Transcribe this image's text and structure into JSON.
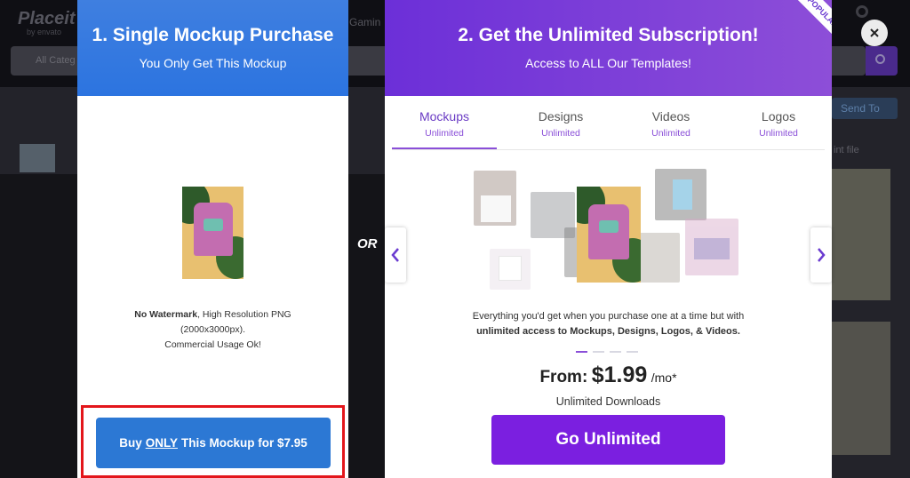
{
  "background": {
    "logo": "Placeit",
    "logo_sub": "by envato",
    "nav_text": "Gamin",
    "search_placeholder": "All Categ",
    "send_button": "Send To",
    "file_text": "int file"
  },
  "single_card": {
    "title": "1. Single Mockup Purchase",
    "subtitle": "You Only Get This Mockup",
    "desc_bold": "No Watermark",
    "desc_line1_rest": ", High Resolution PNG",
    "desc_line2": "(2000x3000px).",
    "desc_line3": "Commercial Usage Ok!",
    "buy_prefix": "Buy",
    "buy_only": "ONLY",
    "buy_suffix": "This Mockup for $7.95"
  },
  "or_label": "OR",
  "subscription_card": {
    "title": "2. Get the Unlimited Subscription!",
    "subtitle": "Access to ALL Our Templates!",
    "ribbon": "POPULAR",
    "tabs": [
      {
        "name": "Mockups",
        "sub": "Unlimited"
      },
      {
        "name": "Designs",
        "sub": "Unlimited"
      },
      {
        "name": "Videos",
        "sub": "Unlimited"
      },
      {
        "name": "Logos",
        "sub": "Unlimited"
      }
    ],
    "desc_line1": "Everything you'd get when you purchase one at a time but with",
    "desc_line2_bold": "unlimited access to Mockups, Designs, Logos, & Videos.",
    "price_from": "From:",
    "price_amount": "$1.99",
    "price_unit": "/mo*",
    "downloads": "Unlimited Downloads",
    "cta": "Go Unlimited"
  },
  "icons": {
    "prev": "chevron-left-icon",
    "next": "chevron-right-icon",
    "close": "close-icon"
  },
  "colors": {
    "single_header": "#2c74e0",
    "subscription_header": "#7a3ad8",
    "buy_button": "#2c78d4",
    "cta_button": "#7b1fe0",
    "highlight": "#e3161b"
  }
}
